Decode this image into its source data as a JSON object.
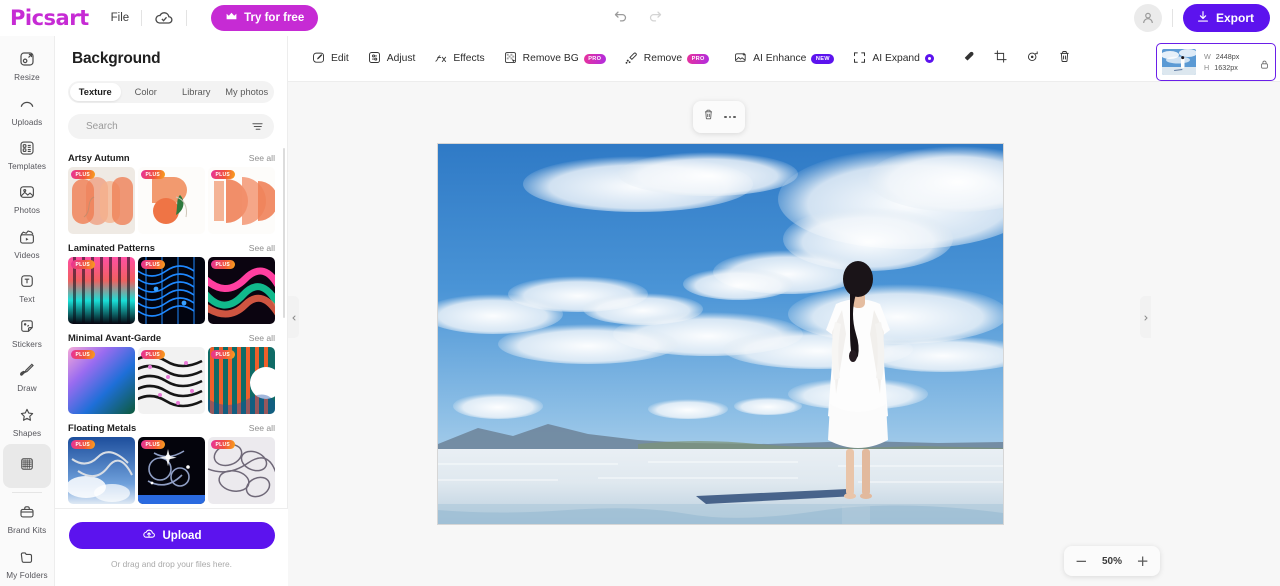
{
  "app": {
    "logo": "Picsart",
    "menu_file": "File",
    "try_free": "Try for free",
    "export": "Export"
  },
  "left_rail": {
    "items": [
      {
        "label": "Resize",
        "icon": "resize-icon",
        "active": false
      },
      {
        "label": "Uploads",
        "icon": "uploads-icon",
        "active": false
      },
      {
        "label": "Templates",
        "icon": "templates-icon",
        "active": false
      },
      {
        "label": "Photos",
        "icon": "photos-icon",
        "active": false
      },
      {
        "label": "Videos",
        "icon": "videos-icon",
        "active": false
      },
      {
        "label": "Text",
        "icon": "text-icon",
        "active": false
      },
      {
        "label": "Stickers",
        "icon": "stickers-icon",
        "active": false
      },
      {
        "label": "Draw",
        "icon": "draw-icon",
        "active": false
      },
      {
        "label": "Shapes",
        "icon": "shapes-icon",
        "active": false
      },
      {
        "label": "",
        "icon": "background-icon",
        "active": true
      },
      {
        "label": "Brand Kits",
        "icon": "brandkits-icon",
        "active": false
      },
      {
        "label": "My Folders",
        "icon": "myfolders-icon",
        "active": false
      }
    ]
  },
  "panel": {
    "title": "Background",
    "tabs": [
      {
        "label": "Texture",
        "active": true
      },
      {
        "label": "Color",
        "active": false
      },
      {
        "label": "Library",
        "active": false
      },
      {
        "label": "My photos",
        "active": false
      }
    ],
    "search_placeholder": "Search",
    "search_value": "",
    "see_all": "See all",
    "plus_badge": "PLUS",
    "sections": [
      {
        "title": "Artsy Autumn"
      },
      {
        "title": "Laminated Patterns"
      },
      {
        "title": "Minimal Avant-Garde"
      },
      {
        "title": "Floating Metals"
      }
    ],
    "upload_label": "Upload",
    "drag_hint": "Or drag and drop your files here."
  },
  "toolbar": {
    "items": [
      {
        "label": "Edit",
        "icon": "edit-icon",
        "badge": ""
      },
      {
        "label": "Adjust",
        "icon": "adjust-icon",
        "badge": ""
      },
      {
        "label": "Effects",
        "icon": "effects-icon",
        "badge": ""
      },
      {
        "label": "Remove BG",
        "icon": "removebg-icon",
        "badge": "PRO"
      },
      {
        "label": "Remove",
        "icon": "remove-icon",
        "badge": "PRO"
      },
      {
        "label": "AI Enhance",
        "icon": "ai-enhance-icon",
        "badge": "NEW"
      },
      {
        "label": "AI Expand",
        "icon": "ai-expand-icon",
        "badge": "DOT"
      }
    ],
    "icon_only": [
      "eraser-icon",
      "crop-icon",
      "rotate-icon",
      "delete-icon"
    ]
  },
  "canvas": {
    "zoom_level": "50%",
    "zoom_out": "−",
    "zoom_in": "+",
    "float_tools": [
      "delete-icon",
      "more-options-icon"
    ]
  },
  "layer": {
    "width_label": "W",
    "width_value": "2448px",
    "height_label": "H",
    "height_value": "1632px",
    "lock_icon": "lock-icon"
  },
  "colors": {
    "brand_pink": "#c62bd4",
    "brand_purple": "#5c13ee",
    "layer_border": "#6a1fe8",
    "sky_blue": "#3a7fc8"
  }
}
